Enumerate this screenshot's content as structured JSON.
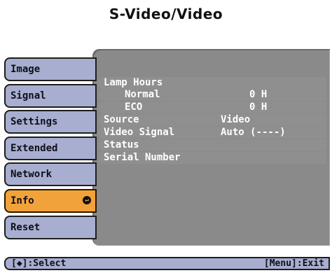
{
  "title": "S-Video/Video",
  "menu": {
    "items": [
      {
        "label": "Image"
      },
      {
        "label": "Signal"
      },
      {
        "label": "Settings"
      },
      {
        "label": "Extended"
      },
      {
        "label": "Network"
      },
      {
        "label": "Info",
        "active": true,
        "icon": "enter-icon"
      },
      {
        "label": "Reset"
      }
    ]
  },
  "info": {
    "lamp_hours": {
      "label": "Lamp Hours"
    },
    "normal": {
      "label": "Normal",
      "value": "0 H"
    },
    "eco": {
      "label": "ECO",
      "value": "0 H"
    },
    "source": {
      "label": "Source",
      "value": "Video"
    },
    "video_signal": {
      "label": "Video Signal",
      "value": "Auto (----)"
    },
    "status": {
      "label": "Status"
    },
    "serial_number": {
      "label": "Serial Number"
    }
  },
  "footer": {
    "select_hint": "[◆]:Select",
    "exit_hint": "[Menu]:Exit"
  },
  "colors": {
    "menu_bg": "#a7aed0",
    "active_bg": "#f2a23a",
    "panel_bg": "#8a8a8a"
  }
}
